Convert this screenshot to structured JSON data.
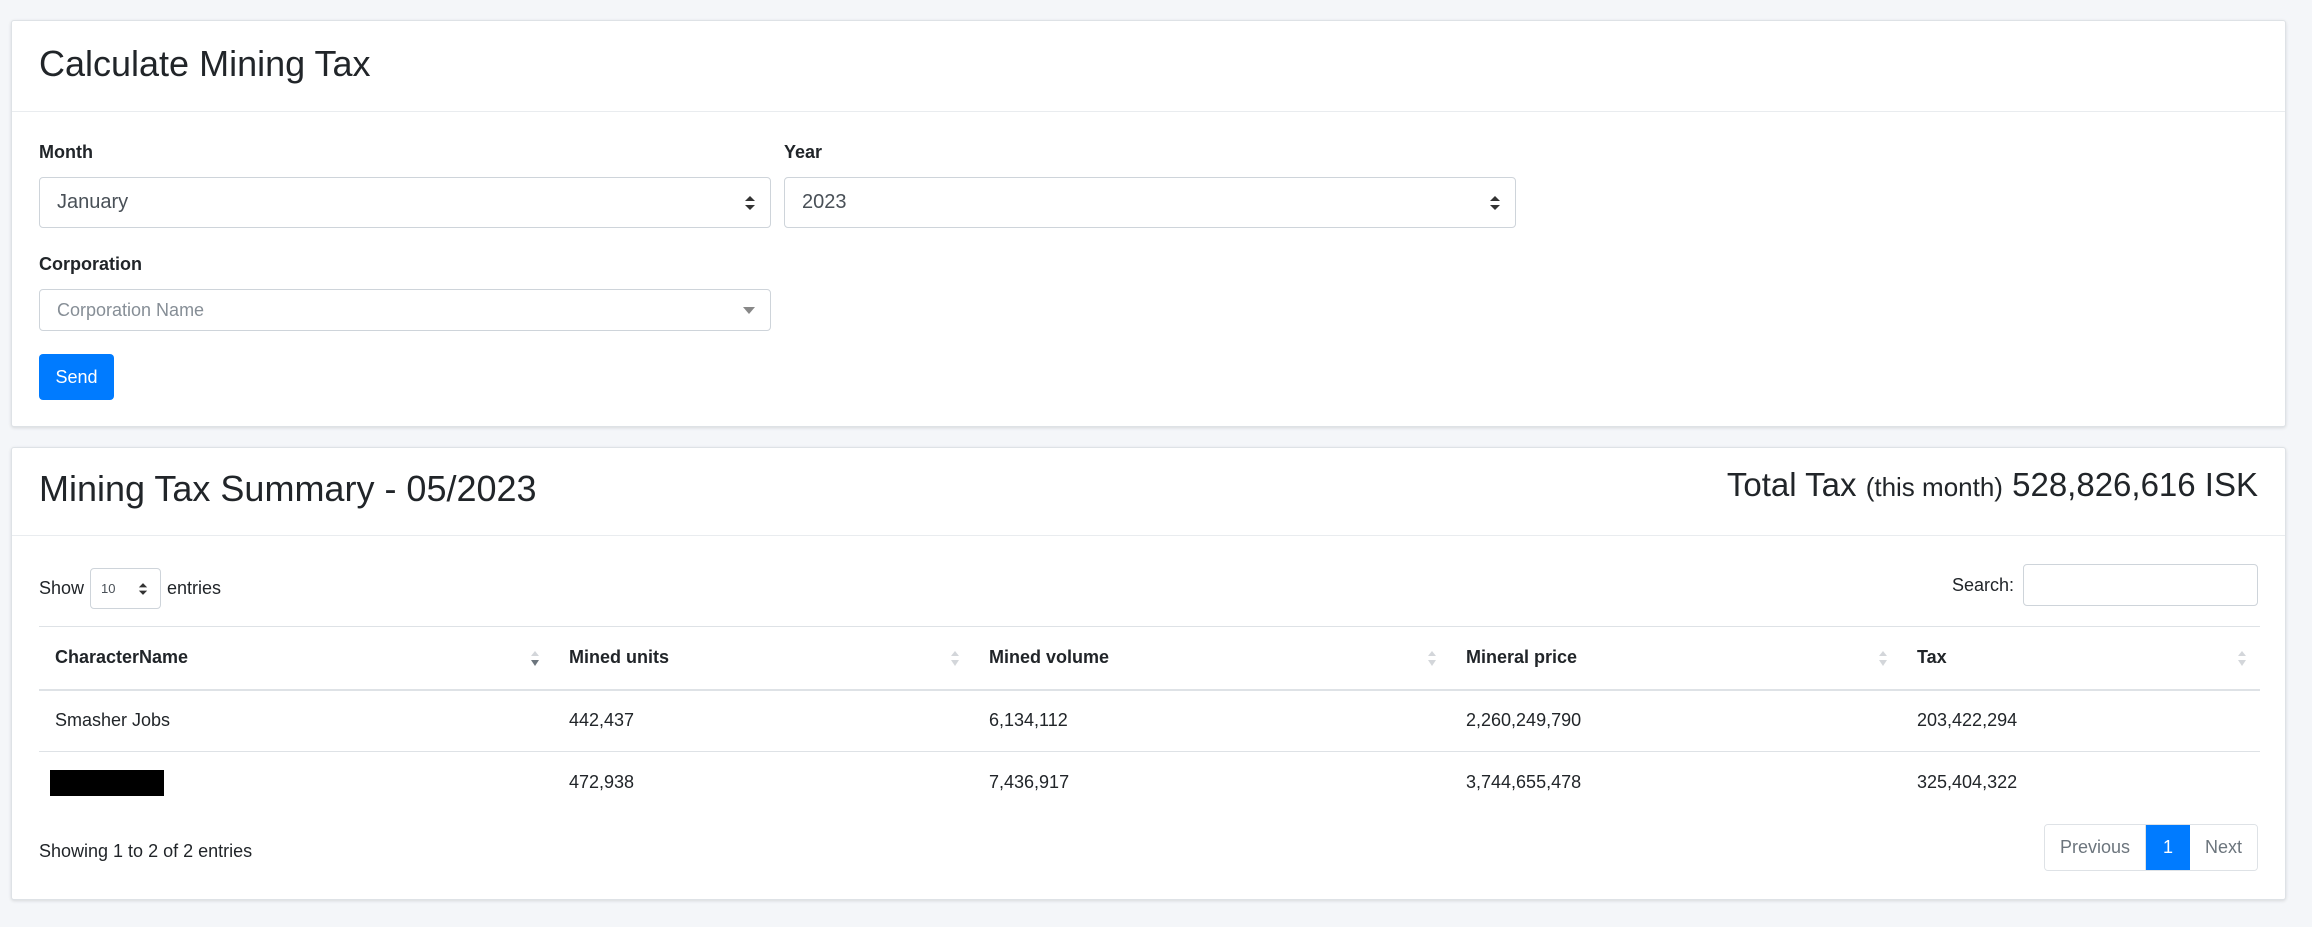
{
  "calc": {
    "title": "Calculate Mining Tax",
    "month_label": "Month",
    "month_value": "January",
    "year_label": "Year",
    "year_value": "2023",
    "corporation_label": "Corporation",
    "corporation_placeholder": "Corporation Name",
    "send_label": "Send"
  },
  "summary": {
    "title": "Mining Tax Summary - 05/2023",
    "total_prefix": "Total Tax",
    "total_qualifier": "(this month)",
    "total_value": "528,826,616 ISK",
    "show_label": "Show",
    "length_value": "10",
    "entries_label": "entries",
    "search_label": "Search:",
    "columns": [
      "CharacterName",
      "Mined units",
      "Mined volume",
      "Mineral price",
      "Tax"
    ],
    "rows": [
      {
        "name": "Smasher Jobs",
        "units": "442,437",
        "volume": "6,134,112",
        "price": "2,260,249,790",
        "tax": "203,422,294",
        "redacted": false
      },
      {
        "name": "",
        "units": "472,938",
        "volume": "7,436,917",
        "price": "3,744,655,478",
        "tax": "325,404,322",
        "redacted": true
      }
    ],
    "info": "Showing 1 to 2 of 2 entries",
    "pagination": {
      "previous": "Previous",
      "current": "1",
      "next": "Next"
    }
  },
  "colors": {
    "primary": "#007bff",
    "background": "#f4f6f9"
  }
}
